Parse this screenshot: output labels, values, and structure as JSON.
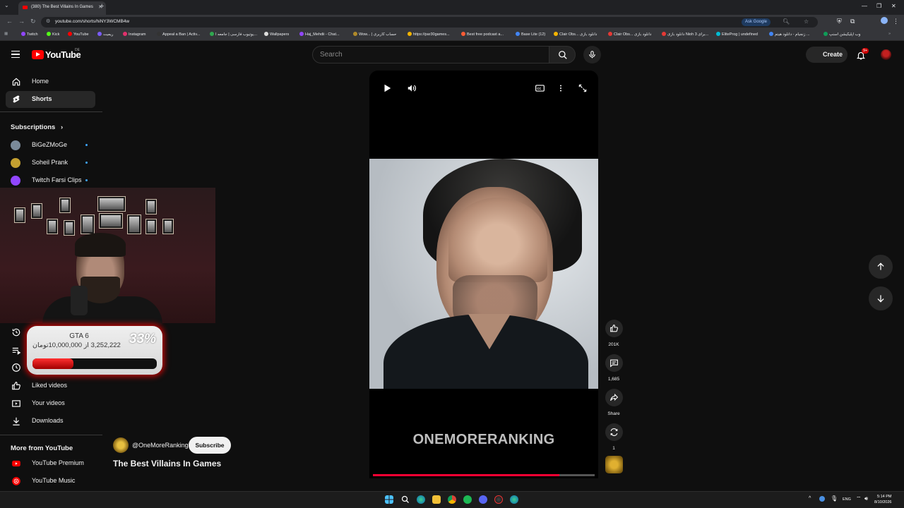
{
  "browser": {
    "tab_title": "(380) The Best Villains In Games",
    "url": "youtube.com/shorts/hiNY3WCMB4w",
    "ask_google": "Ask Google",
    "bookmarks": [
      "Twitch",
      "Kick",
      "YouTube",
      "ریمیت",
      "Instagram",
      "Appeal a Ban | Activ...",
      "یوتیوب فارسی | جامعه ا...",
      "Wallpapers",
      "Haj_Mehdii - Chat...",
      "Wow... | حساب کاربری",
      "https://par30games...",
      "Best free podcast a...",
      "Base Lite (12)",
      "Clair Obs... دانلود بازی",
      "Clair Obs... دانلود بازی",
      "دانلود بازی Nioh 3 برای...",
      "EliteProg | undefined",
      "زنجیام - دانلود هیتم ...",
      "وب اپلیکیشن اسنپ"
    ]
  },
  "header": {
    "logo_text": "YouTube",
    "region": "DE",
    "search_placeholder": "Search",
    "create_label": "Create",
    "notif_count": "9+"
  },
  "sidebar": {
    "home": "Home",
    "shorts": "Shorts",
    "subscriptions_heading": "Subscriptions",
    "subscriptions": [
      {
        "name": "BiGeZMoGe",
        "color": "#7a8a9a"
      },
      {
        "name": "Soheil Prank",
        "color": "#c4a030"
      },
      {
        "name": "Twitch Farsi Clips",
        "color": "#9146ff"
      }
    ],
    "liked_videos": "Liked videos",
    "your_videos": "Your videos",
    "downloads": "Downloads",
    "more_heading": "More from YouTube",
    "yt_premium": "YouTube Premium",
    "yt_music": "YouTube Music"
  },
  "donation": {
    "title": "GTA 6",
    "amount_text": "3,252,222 از 10,000,000تومان",
    "percent_text": "33%",
    "progress_fraction": 0.33
  },
  "short": {
    "brand_text": "ONEMORERANKING",
    "progress_fraction": 0.84,
    "channel_handle": "@OneMoreRanking",
    "subscribe_label": "Subscribe",
    "title": "The Best Villains In Games",
    "likes": "201K",
    "comments": "1,685",
    "share_label": "Share",
    "remix_count": "1"
  },
  "taskbar": {
    "lang": "ENG",
    "time": "5:14 PM",
    "date": "8/10/2026"
  },
  "colors": {
    "accent": "#ff0000",
    "background": "#0f0f0f",
    "link_blue": "#3ea6ff"
  }
}
